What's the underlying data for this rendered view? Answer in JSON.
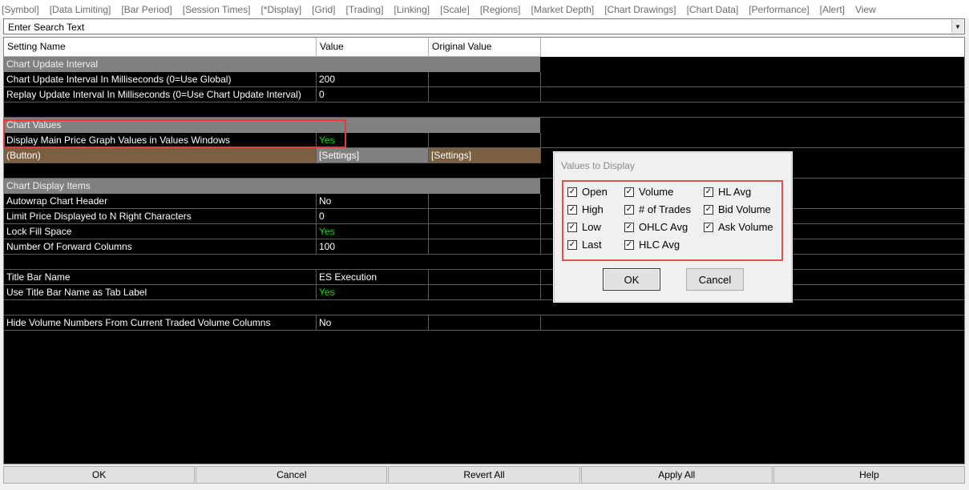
{
  "tabs": [
    "[Symbol]",
    "[Data Limiting]",
    "[Bar Period]",
    "[Session Times]",
    "[*Display]",
    "[Grid]",
    "[Trading]",
    "[Linking]",
    "[Scale]",
    "[Regions]",
    "[Market Depth]",
    "[Chart Drawings]",
    "[Chart Data]",
    "[Performance]",
    "[Alert]",
    "View"
  ],
  "search": {
    "value": "Enter Search Text"
  },
  "grid": {
    "headers": {
      "name": "Setting Name",
      "value": "Value",
      "original": "Original Value"
    },
    "sections": {
      "update": "Chart Update Interval",
      "values": "Chart Values",
      "display": "Chart Display Items"
    },
    "rows": {
      "r1": {
        "name": "Chart Update Interval In Milliseconds (0=Use Global)",
        "value": "200"
      },
      "r2": {
        "name": "Replay Update Interval In Milliseconds (0=Use Chart Update Interval)",
        "value": "0"
      },
      "r3": {
        "name": "Display Main Price Graph Values in Values Windows",
        "value": "Yes"
      },
      "r4": {
        "name": " (Button)",
        "value": "[Settings]",
        "original": "[Settings]"
      },
      "r5": {
        "name": "Autowrap Chart Header",
        "value": "No"
      },
      "r6": {
        "name": "Limit Price Displayed to N Right Characters",
        "value": "0"
      },
      "r7": {
        "name": "Lock Fill Space",
        "value": "Yes"
      },
      "r8": {
        "name": "Number Of Forward Columns",
        "value": "100"
      },
      "r9": {
        "name": "Title Bar Name",
        "value": "ES Execution"
      },
      "r10": {
        "name": "Use Title Bar Name as Tab Label",
        "value": "Yes"
      },
      "r11": {
        "name": "Hide Volume Numbers From Current Traded Volume Columns",
        "value": "No"
      }
    }
  },
  "dialog": {
    "title": "Values to Display",
    "checkboxes": {
      "open": "Open",
      "high": "High",
      "low": "Low",
      "last": "Last",
      "volume": "Volume",
      "trades": "# of Trades",
      "ohlc": "OHLC Avg",
      "hlc": "HLC Avg",
      "hl": "HL Avg",
      "bid": "Bid Volume",
      "ask": "Ask Volume"
    },
    "checkmark": "✓",
    "ok": "OK",
    "cancel": "Cancel"
  },
  "bottom": {
    "ok": "OK",
    "cancel": "Cancel",
    "revert": "Revert All",
    "apply": "Apply All",
    "help": "Help"
  },
  "colors": {
    "grid_bg": "#000000",
    "section_bg": "#808080",
    "yes_text": "#00e000",
    "button_row_bg": "#7a6040",
    "highlight": "#e53b3b"
  }
}
